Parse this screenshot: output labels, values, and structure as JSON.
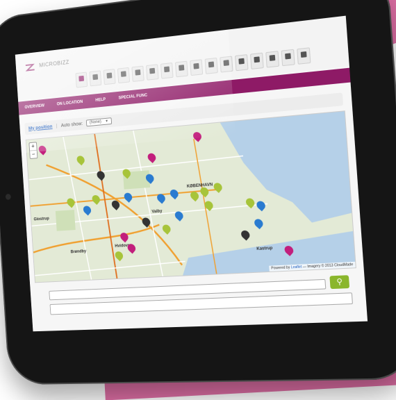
{
  "app": {
    "title": "MICROBIZZ",
    "brand_color": "#8e1a66"
  },
  "toolbar": {
    "icons": [
      "home-icon",
      "building-icon",
      "grid-icon",
      "book-icon",
      "clipboard-icon",
      "transfer-icon",
      "person-icon",
      "calendar-icon",
      "refresh-icon",
      "list-icon",
      "apps-icon",
      "support-icon",
      "file-icon",
      "search-icon",
      "briefcase-icon",
      "tools-icon"
    ]
  },
  "nav": {
    "items": [
      "OVERVIEW",
      "ON LOCATION",
      "HELP",
      "SPECIAL FUNC"
    ]
  },
  "controls": {
    "my_position": "My position",
    "separator": "|",
    "auto_show_label": "Auto show:",
    "auto_show_value": "(None)"
  },
  "map": {
    "zoom_in": "+",
    "zoom_out": "−",
    "attribution_prefix": "Powered by",
    "attribution_link": "Leaflet",
    "attribution_suffix": "— Imagery © 2013 CloudMade",
    "places": [
      "KØBENHAVN",
      "Glostrup",
      "Valby",
      "Brøndby",
      "Hvidovre",
      "Kastrup"
    ],
    "pin_colors": {
      "green": "#a7c43a",
      "magenta": "#c21e7c",
      "blue": "#2a7bd0",
      "dark": "#333333"
    }
  },
  "search": {
    "button_icon": "search-icon"
  }
}
